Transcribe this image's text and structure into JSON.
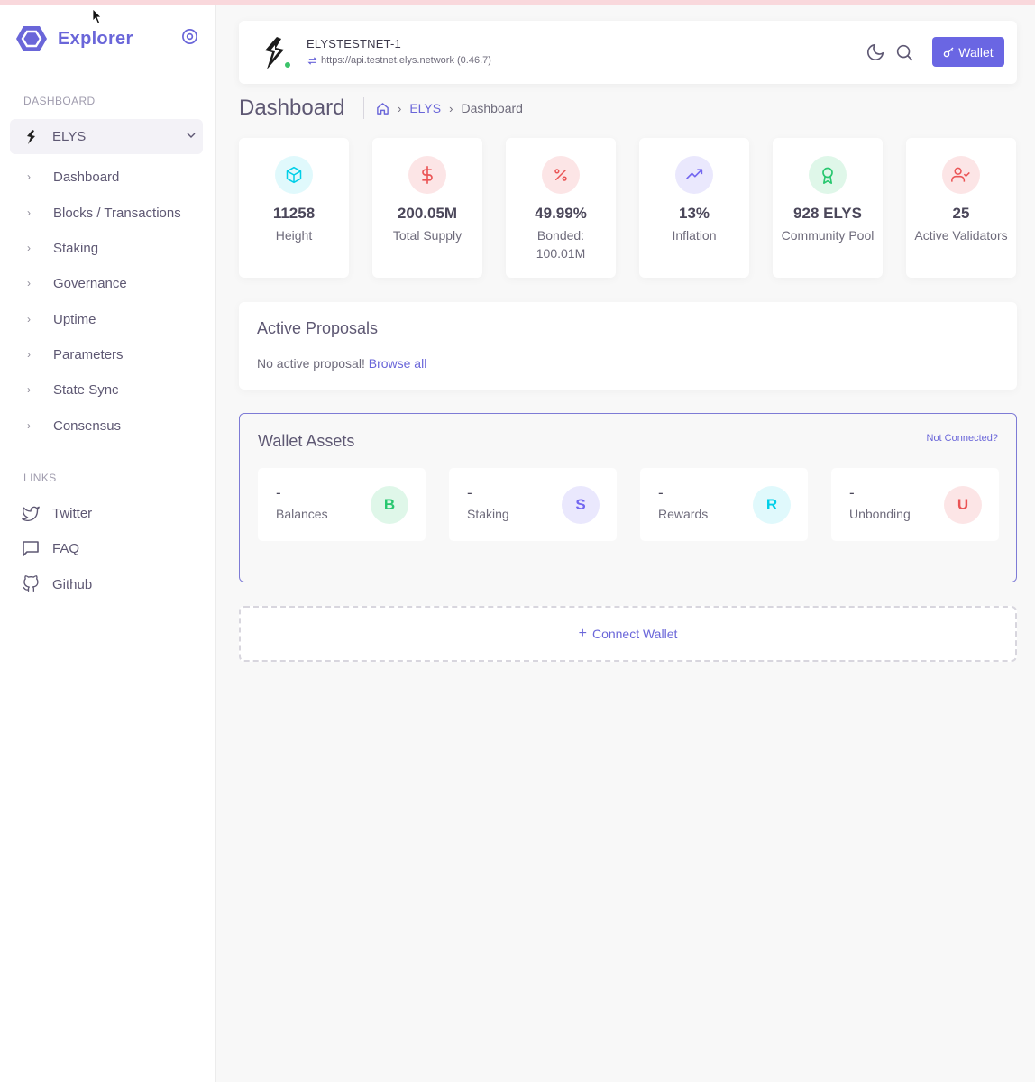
{
  "brand": {
    "name": "Explorer"
  },
  "sidebar": {
    "dashboard_section": "DASHBOARD",
    "chain": {
      "name": "ELYS"
    },
    "items": [
      {
        "label": "Dashboard"
      },
      {
        "label": "Blocks / Transactions"
      },
      {
        "label": "Staking"
      },
      {
        "label": "Governance"
      },
      {
        "label": "Uptime"
      },
      {
        "label": "Parameters"
      },
      {
        "label": "State Sync"
      },
      {
        "label": "Consensus"
      }
    ],
    "links_section": "LINKS",
    "links": [
      {
        "label": "Twitter",
        "icon": "twitter-icon"
      },
      {
        "label": "FAQ",
        "icon": "chat-icon"
      },
      {
        "label": "Github",
        "icon": "github-icon"
      }
    ]
  },
  "navbar": {
    "chain_id": "ELYSTESTNET-1",
    "endpoint": "https://api.testnet.elys.network (0.46.7)",
    "wallet_label": "Wallet"
  },
  "page": {
    "title": "Dashboard",
    "breadcrumb": {
      "link": "ELYS",
      "current": "Dashboard"
    }
  },
  "stats": [
    {
      "value": "11258",
      "label": "Height",
      "icon": "cube-icon",
      "color": "#00cfe8"
    },
    {
      "value": "200.05M",
      "label": "Total Supply",
      "icon": "dollar-icon",
      "color": "#ea5455"
    },
    {
      "value": "49.99%",
      "label": "Bonded: 100.01M",
      "icon": "percent-icon",
      "color": "#ea5455"
    },
    {
      "value": "13%",
      "label": "Inflation",
      "icon": "trending-up-icon",
      "color": "#7367f0"
    },
    {
      "value": "928 ELYS",
      "label": "Community Pool",
      "icon": "award-icon",
      "color": "#28c76f"
    },
    {
      "value": "25",
      "label": "Active Validators",
      "icon": "user-check-icon",
      "color": "#ea5455"
    }
  ],
  "proposals": {
    "title": "Active Proposals",
    "message": "No active proposal!",
    "browse_label": "Browse all"
  },
  "wallet_assets": {
    "title": "Wallet Assets",
    "not_connected": "Not Connected?",
    "items": [
      {
        "value": "-",
        "label": "Balances",
        "letter": "B",
        "color": "#28c76f"
      },
      {
        "value": "-",
        "label": "Staking",
        "letter": "S",
        "color": "#7367f0"
      },
      {
        "value": "-",
        "label": "Rewards",
        "letter": "R",
        "color": "#00cfe8"
      },
      {
        "value": "-",
        "label": "Unbonding",
        "letter": "U",
        "color": "#ea5455"
      }
    ]
  },
  "connect_wallet": {
    "label": "Connect Wallet"
  }
}
